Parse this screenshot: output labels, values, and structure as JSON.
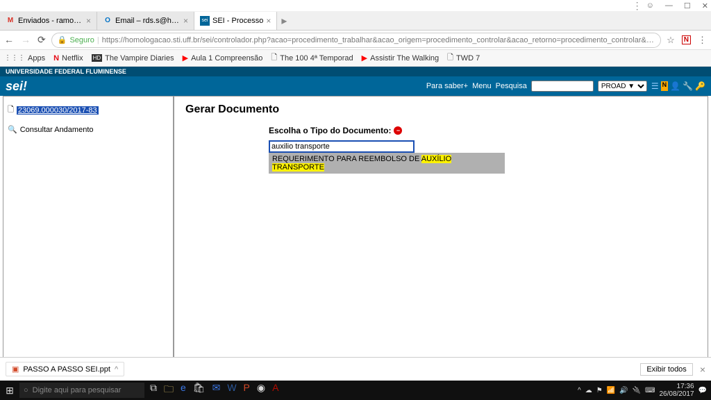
{
  "window": {
    "user_icon": "☺",
    "min": "—",
    "max": "☐",
    "close": "✕"
  },
  "tabs": [
    {
      "favicon": "M",
      "favicon_color": "#d93025",
      "label": "Enviados - ramonsantos"
    },
    {
      "favicon": "O",
      "favicon_color": "#0072c6",
      "label": "Email – rds.s@hotmail.co"
    },
    {
      "favicon": "sei",
      "favicon_color": "#006699",
      "label": "SEI - Processo"
    }
  ],
  "address": {
    "secure_label": "Seguro",
    "url": "https://homologacao.sti.uff.br/sei/controlador.php?acao=procedimento_trabalhar&acao_origem=procedimento_controlar&acao_retorno=procedimento_controlar&id_proced…"
  },
  "bookmarks": {
    "apps": "Apps",
    "netflix": "Netflix",
    "vampire": "The Vampire Diaries",
    "aula": "Aula 1 Compreensão",
    "the100": "The 100 4ª Temporad",
    "twd": "Assistir The Walking",
    "twd7": "TWD 7"
  },
  "sei_header": {
    "university": "UNIVERSIDADE FEDERAL FLUMINENSE",
    "logo": "sei!",
    "para_saber": "Para saber+",
    "menu": "Menu",
    "pesquisa": "Pesquisa",
    "unit": "PROAD ▼"
  },
  "tree": {
    "process_number": "23069.000030/2017-83",
    "consultar": "Consultar Andamento"
  },
  "pane": {
    "title": "Gerar Documento",
    "choose_label": "Escolha o Tipo do Documento:",
    "filter_value": "auxilio transporte",
    "option_prefix": "REQUERIMENTO PARA REEMBOLSO DE ",
    "option_hl1": "AUXÍLIO",
    "option_mid": " ",
    "option_hl2": "TRANSPORTE"
  },
  "downloads": {
    "file": "PASSO A PASSO SEI.ppt",
    "show_all": "Exibir todos"
  },
  "taskbar": {
    "search_placeholder": "Digite aqui para pesquisar",
    "time": "17:36",
    "date": "26/08/2017"
  }
}
